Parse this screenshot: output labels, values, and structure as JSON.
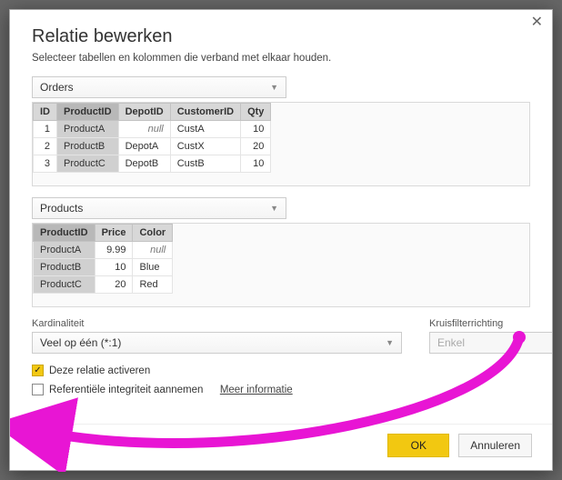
{
  "dialog": {
    "title": "Relatie bewerken",
    "subtitle": "Selecteer tabellen en kolommen die verband met elkaar houden.",
    "close": "✕"
  },
  "table1": {
    "name": "Orders",
    "columns": [
      "ID",
      "ProductID",
      "DepotID",
      "CustomerID",
      "Qty"
    ],
    "selected_column": "ProductID",
    "rows": [
      {
        "ID": "1",
        "ProductID": "ProductA",
        "DepotID": "null",
        "CustomerID": "CustA",
        "Qty": "10"
      },
      {
        "ID": "2",
        "ProductID": "ProductB",
        "DepotID": "DepotA",
        "CustomerID": "CustX",
        "Qty": "20"
      },
      {
        "ID": "3",
        "ProductID": "ProductC",
        "DepotID": "DepotB",
        "CustomerID": "CustB",
        "Qty": "10"
      }
    ]
  },
  "table2": {
    "name": "Products",
    "columns": [
      "ProductID",
      "Price",
      "Color"
    ],
    "selected_column": "ProductID",
    "rows": [
      {
        "ProductID": "ProductA",
        "Price": "9.99",
        "Color": "null"
      },
      {
        "ProductID": "ProductB",
        "Price": "10",
        "Color": "Blue"
      },
      {
        "ProductID": "ProductC",
        "Price": "20",
        "Color": "Red"
      }
    ]
  },
  "options": {
    "cardinality_label": "Kardinaliteit",
    "cardinality_value": "Veel op één (*:1)",
    "crossfilter_label": "Kruisfilterrichting",
    "crossfilter_value": "Enkel",
    "activate_label": "Deze relatie activeren",
    "activate_checked": true,
    "assume_ri_label": "Referentiële integriteit aannemen",
    "assume_ri_checked": false,
    "more_info": "Meer informatie"
  },
  "buttons": {
    "ok": "OK",
    "cancel": "Annuleren"
  },
  "annotation_color": "#e815d4"
}
